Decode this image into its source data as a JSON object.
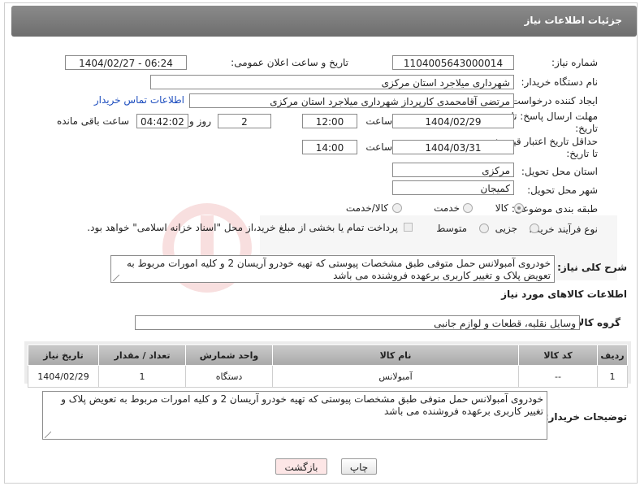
{
  "header": {
    "title": "جزئیات اطلاعات نیاز"
  },
  "fields": {
    "need_number_label": "شماره نیاز:",
    "need_number": "1104005643000014",
    "announce_label": "تاریخ و ساعت اعلان عمومی:",
    "announce_value": "1404/02/27 - 06:24",
    "buyer_org_label": "نام دستگاه خریدار:",
    "buyer_org": "شهرداری میلاجرد استان مرکزی",
    "creator_label": "ایجاد کننده درخواست:",
    "creator": "مرتضی  آقامحمدی  کارپرداز  شهرداری میلاجرد استان مرکزی",
    "contact_link": "اطلاعات تماس خریدار",
    "reply_deadline_label_1": "مهلت ارسال پاسخ: تا",
    "reply_deadline_label_2": "تاریخ:",
    "reply_date": "1404/02/29",
    "time_label": "ساعت",
    "reply_time": "12:00",
    "days_value": "2",
    "days_label": "روز و",
    "remaining_time": "04:42:02",
    "remaining_label": "ساعت باقی مانده",
    "price_deadline_label_1": "حداقل تاریخ اعتبار قیمت:",
    "price_deadline_label_2": "تا تاریخ:",
    "price_date": "1404/03/31",
    "price_time": "14:00",
    "province_label": "استان محل تحویل:",
    "province": "مرکزی",
    "city_label": "شهر محل تحویل:",
    "city": "کمیجان",
    "category_label": "طبقه بندی موضوعی:",
    "category_options": [
      "کالا",
      "خدمت",
      "کالا/خدمت"
    ],
    "process_label": "نوع فرآیند خرید :",
    "process_options": [
      "جزیی",
      "متوسط"
    ],
    "payment_note": "پرداخت تمام یا بخشی از مبلغ خرید،از محل \"اسناد خزانه اسلامی\" خواهد بود.",
    "summary_label": "شرح کلی نیاز:",
    "summary": "خودروی آمبولانس حمل متوفی طبق مشخصات پیوستی که تهیه خودرو آریسان 2   و  کلیه امورات مربوط به تعویض پلاک و تغییر کاربری برعهده فروشنده می باشد"
  },
  "goods": {
    "section_title": "اطلاعات کالاهای مورد نیاز",
    "group_label": "گروه کالا:",
    "group": "وسایل نقلیه، قطعات و لوازم جانبی",
    "columns": [
      "ردیف",
      "کد کالا",
      "نام کالا",
      "واحد شمارش",
      "تعداد / مقدار",
      "تاریخ نیاز"
    ],
    "rows": [
      [
        "1",
        "--",
        "آمبولانس",
        "دستگاه",
        "1",
        "1404/02/29"
      ]
    ]
  },
  "buyer_notes_label": "توضیحات خریدار:",
  "buyer_notes": "خودروی آمبولانس حمل متوفی طبق مشخصات پیوستی که تهیه خودرو آریسان 2   و  کلیه امورات مربوط به تعویض پلاک و تغییر کاربری برعهده فروشنده می باشد",
  "buttons": {
    "print": "چاپ",
    "back": "بازگشت"
  },
  "colors": {
    "header": "#7a7a7a",
    "link": "#1f4fbf",
    "back_btn": "#fde6e6"
  }
}
